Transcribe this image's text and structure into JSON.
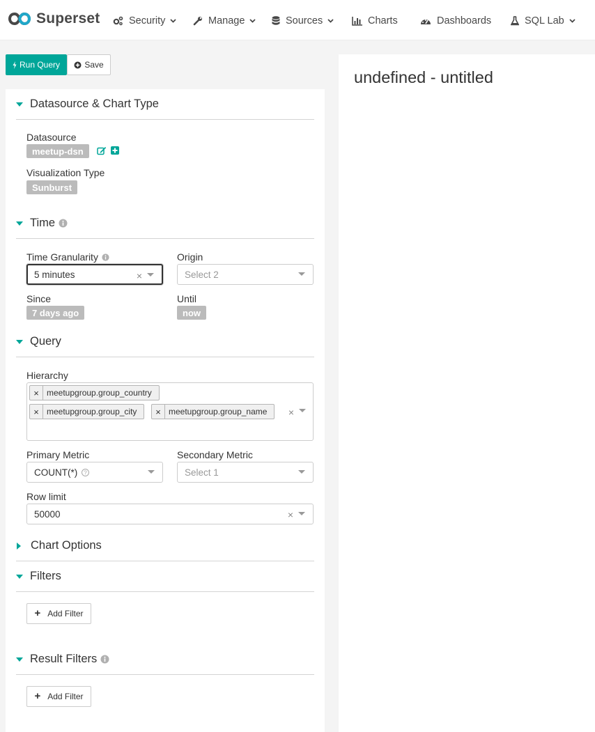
{
  "brand": {
    "name": "Superset"
  },
  "nav": {
    "security": "Security",
    "manage": "Manage",
    "sources": "Sources",
    "charts": "Charts",
    "dashboards": "Dashboards",
    "sqllab": "SQL Lab"
  },
  "toolbar": {
    "run_label": "Run Query",
    "save_label": "Save"
  },
  "datasource_section": {
    "title": "Datasource & Chart Type",
    "datasource_label": "Datasource",
    "datasource_value": "meetup-dsn",
    "viz_label": "Visualization Type",
    "viz_value": "Sunburst"
  },
  "time_section": {
    "title": "Time",
    "granularity_label": "Time Granularity",
    "granularity_value": "5 minutes",
    "origin_label": "Origin",
    "origin_placeholder": "Select 2",
    "since_label": "Since",
    "since_value": "7 days ago",
    "until_label": "Until",
    "until_value": "now"
  },
  "query_section": {
    "title": "Query",
    "hierarchy_label": "Hierarchy",
    "hierarchy": [
      "meetupgroup.group_country",
      "meetupgroup.group_city",
      "meetupgroup.group_name"
    ],
    "primary_metric_label": "Primary Metric",
    "primary_metric_value": "COUNT(*)",
    "secondary_metric_label": "Secondary Metric",
    "secondary_metric_placeholder": "Select 1",
    "row_limit_label": "Row limit",
    "row_limit_value": "50000"
  },
  "chart_options_section": {
    "title": "Chart Options"
  },
  "filters_section": {
    "title": "Filters",
    "add_label": "Add Filter"
  },
  "result_filters_section": {
    "title": "Result Filters",
    "add_label": "Add Filter"
  },
  "chart": {
    "title": "undefined - untitled"
  },
  "colors": {
    "accent": "#00a699",
    "tag_bg": "#bbbbbb"
  }
}
